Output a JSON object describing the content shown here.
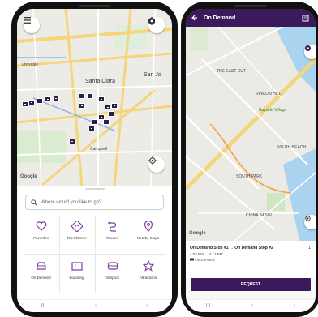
{
  "colors": {
    "brand_purple": "#3b1a5b",
    "pin_dark": "#2a1f4a",
    "map_bg": "#ecebe6",
    "park_green": "#cfe6c3",
    "water_blue": "#a9d3ee",
    "highway_yellow": "#f5d57a"
  },
  "left_phone": {
    "map": {
      "labels": {
        "sunnyvale": "unnyvale",
        "santa_clara": "Santa Clara",
        "san_jose": "San Jo",
        "campbell": "Campbell",
        "google": "Google"
      },
      "icons": {
        "menu": "menu-icon",
        "settings": "settings-icon",
        "locate": "locate-icon"
      }
    },
    "search": {
      "placeholder": "Where would you like to go?"
    },
    "tiles": [
      {
        "label": "Favorites",
        "icon": "heart-icon"
      },
      {
        "label": "Trip Planner",
        "icon": "trip-planner-icon"
      },
      {
        "label": "Routes",
        "icon": "routes-icon"
      },
      {
        "label": "Nearby Stops",
        "icon": "location-pin-icon"
      },
      {
        "label": "On Demand",
        "icon": "car-icon"
      },
      {
        "label": "Boarding",
        "icon": "ticket-icon"
      },
      {
        "label": "Vanpool",
        "icon": "van-icon"
      },
      {
        "label": "Attractions",
        "icon": "star-icon"
      }
    ],
    "navbar": {
      "recent": "III",
      "home": "○",
      "back": "‹"
    }
  },
  "right_phone": {
    "header": {
      "title": "On Demand"
    },
    "map": {
      "labels": {
        "east_cut": "THE EAST CUT",
        "rincon_hill": "RINCON HILL",
        "bayside_village": "Bayside Village",
        "south_beach": "SOUTH BEACH",
        "south_park": "SOUTH PARK",
        "china_basin": "CHINA BASIN",
        "google": "Google"
      }
    },
    "trip": {
      "title": "On Demand Stop #1 → On Demand Stop #2",
      "count": "1",
      "time": "4:03 PM → 4:13 PM",
      "service": "On Demand"
    },
    "request_label": "REQUEST",
    "navbar": {
      "recent": "III",
      "home": "○",
      "back": "‹"
    }
  }
}
